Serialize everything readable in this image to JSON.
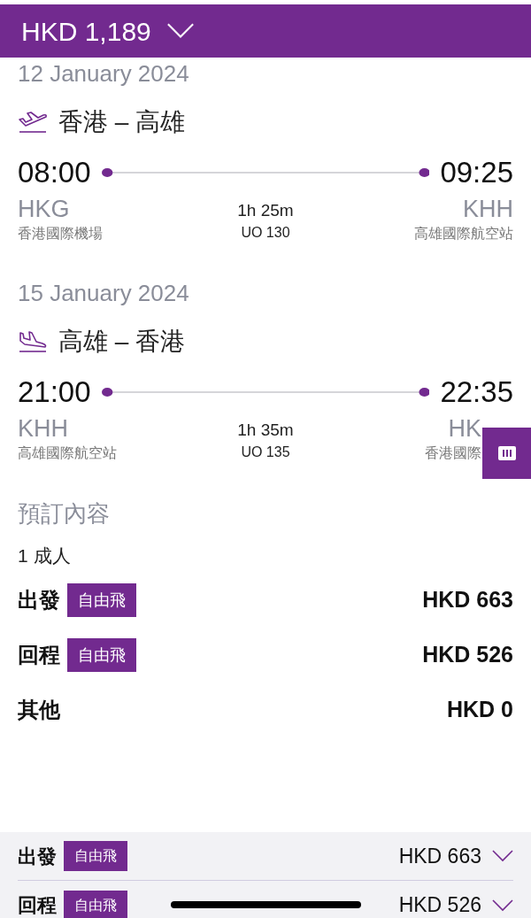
{
  "header": {
    "total": "HKD 1,189"
  },
  "flights": [
    {
      "kind": "outbound",
      "date": "12 January 2024",
      "route": "香港 – 高雄",
      "dep_time": "08:00",
      "arr_time": "09:25",
      "dep_code": "HKG",
      "arr_code": "KHH",
      "dep_airport": "香港國際機場",
      "arr_airport": "高雄國際航空站",
      "duration": "1h 25m",
      "flight_no": "UO 130",
      "covered": false
    },
    {
      "kind": "return",
      "date": "15 January 2024",
      "route": "高雄 – 香港",
      "dep_time": "21:00",
      "arr_time": "22:35",
      "dep_code": "KHH",
      "arr_code": "HK",
      "dep_airport": "高雄國際航空站",
      "arr_airport": "香港國際",
      "duration": "1h 35m",
      "flight_no": "UO 135",
      "covered": true
    }
  ],
  "summary": {
    "title": "預訂內容",
    "passengers": "1 成人",
    "rows": [
      {
        "label": "出發",
        "tag": "自由飛",
        "price": "HKD 663"
      },
      {
        "label": "回程",
        "tag": "自由飛",
        "price": "HKD 526"
      },
      {
        "label": "其他",
        "price": "HKD 0"
      }
    ]
  },
  "footer": [
    {
      "label": "出發",
      "tag": "自由飛",
      "price": "HKD 663"
    },
    {
      "label": "回程",
      "tag": "自由飛",
      "price": "HKD 526"
    }
  ]
}
